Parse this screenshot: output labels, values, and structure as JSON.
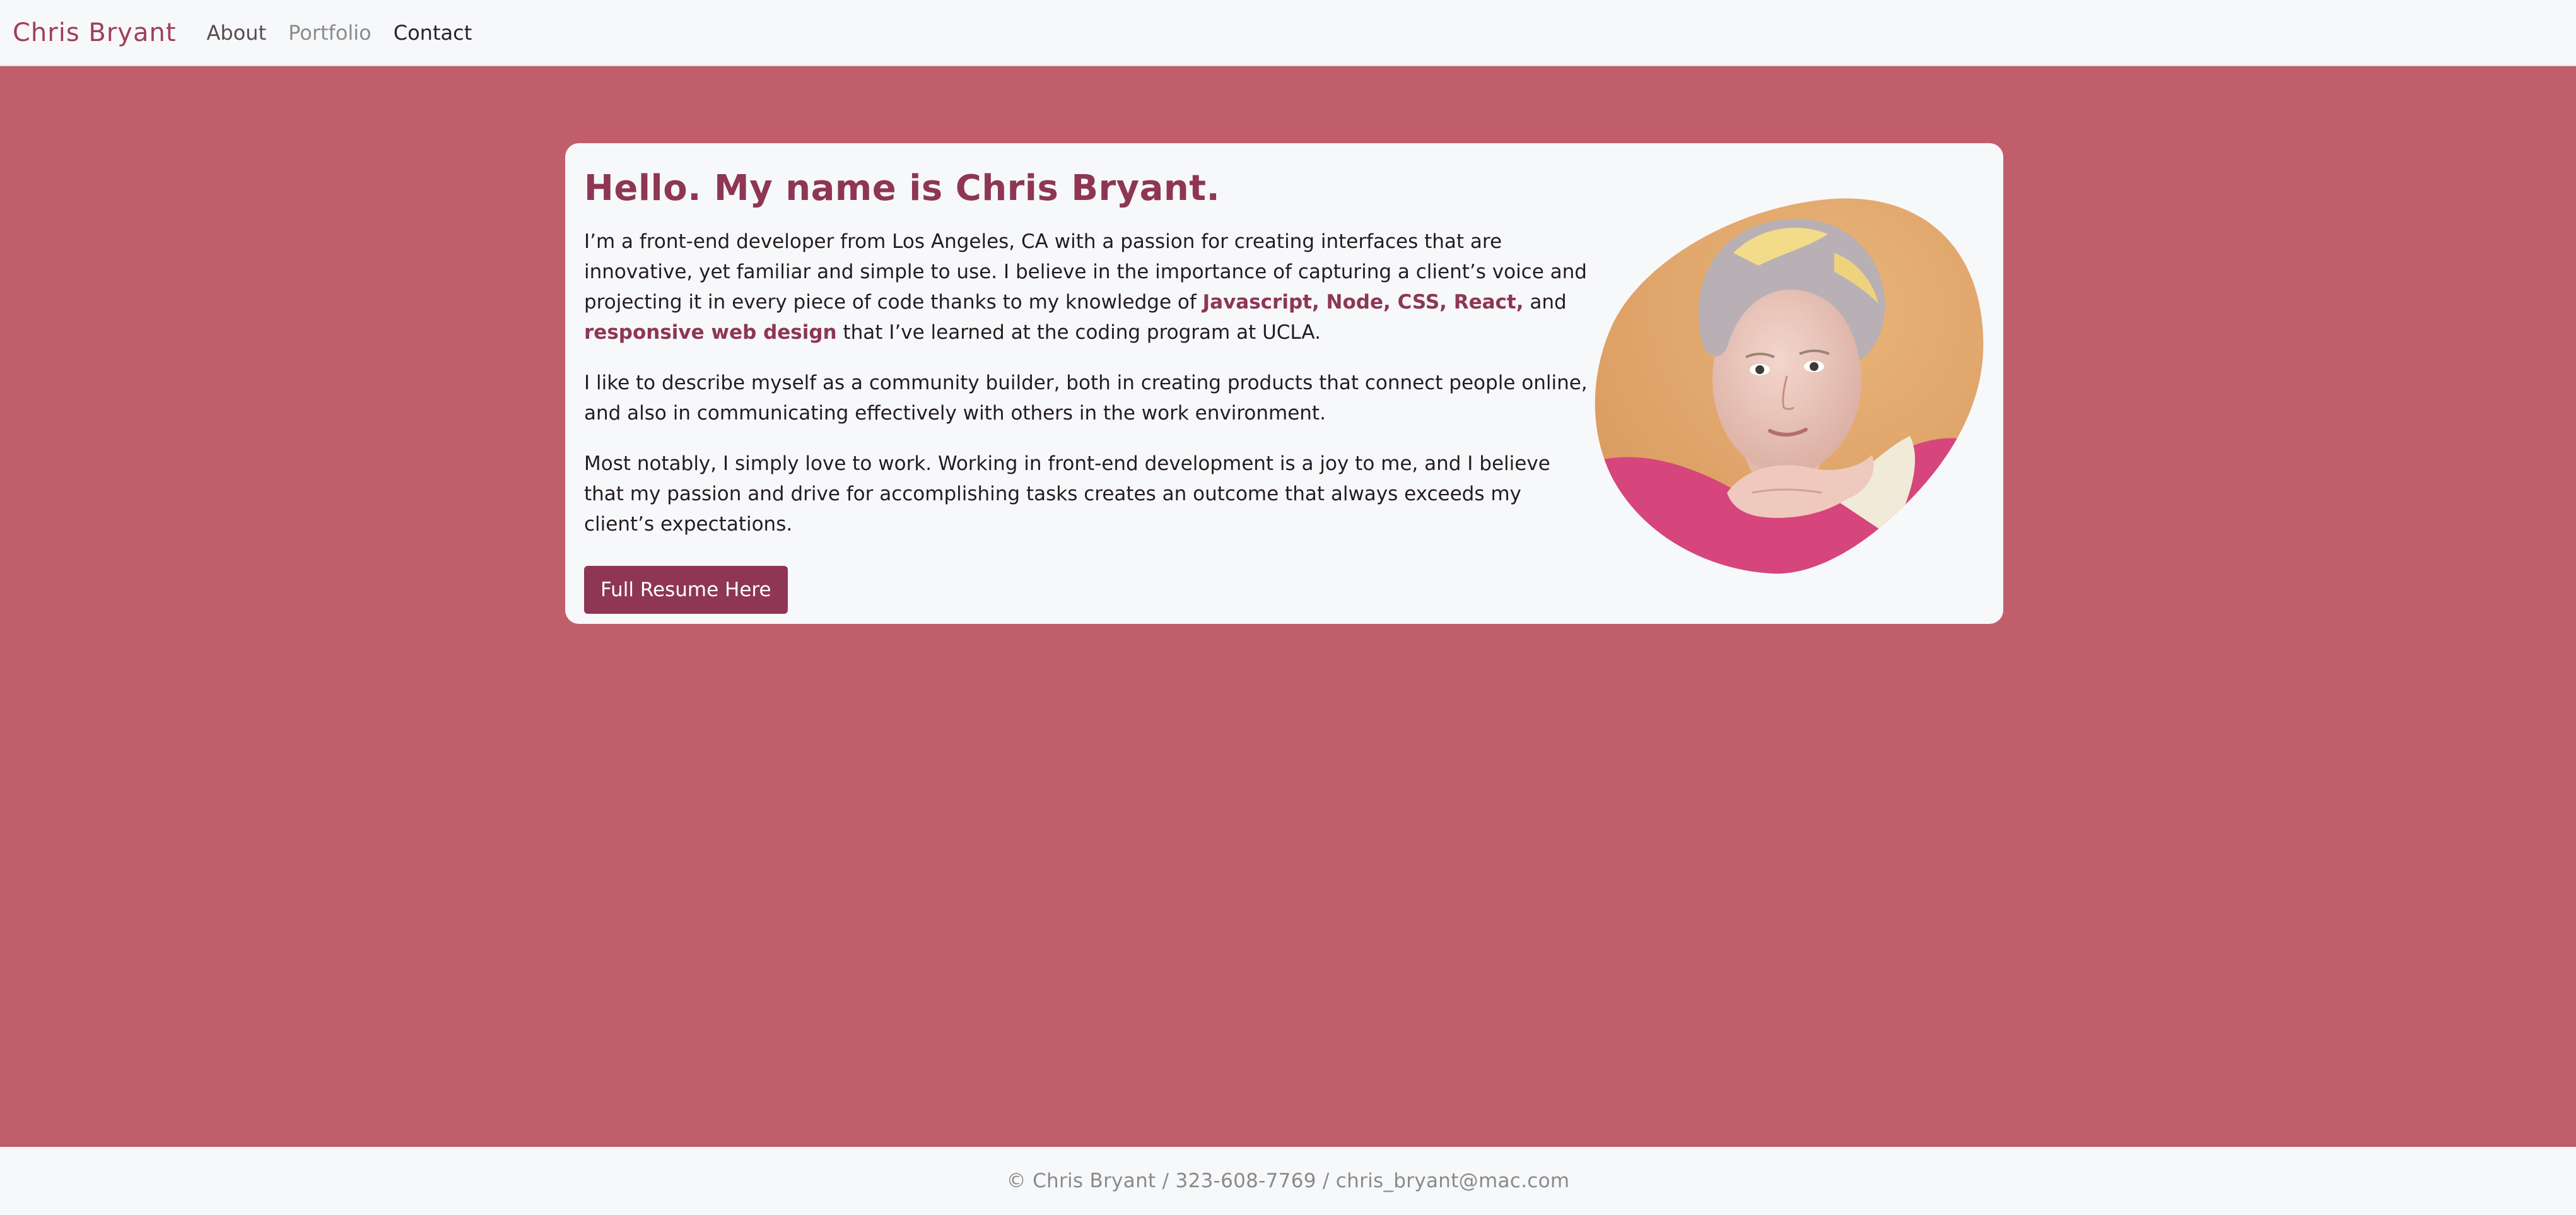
{
  "nav": {
    "brand": "Chris Bryant",
    "links": [
      "About",
      "Portfolio",
      "Contact"
    ]
  },
  "hero": {
    "headline": "Hello. My name is Chris Bryant.",
    "p1_a": "I’m a front-end developer from Los Angeles, CA with a passion for creating interfaces that are innovative, yet familiar and simple to use. I believe in the importance of capturing a client’s voice and projecting it in every piece of code thanks to my knowledge of ",
    "skills": "Javascript, Node, CSS, React,",
    "p1_and": " and ",
    "rwd": "responsive web design",
    "p1_b": " that I’ve learned at the coding program at UCLA.",
    "p2": "I like to describe myself as a community builder, both in creating products that connect people online, and also in communicating effectively with others in the work environment.",
    "p3": "Most notably, I simply love to work. Working in front-end development is a joy to me, and I believe that my passion and drive for accomplishing tasks creates an outcome that always exceeds my client’s expectations.",
    "resume_button": "Full Resume Here",
    "portrait_icon": "portrait-photo"
  },
  "footer": {
    "text": "© Chris Bryant / 323-608-7769 / chris_bryant@mac.com"
  },
  "colors": {
    "page_bg": "#c05e6c",
    "accent": "#8e3654",
    "card_bg": "#f7f8fa",
    "portrait_bg": "#e0a468"
  }
}
